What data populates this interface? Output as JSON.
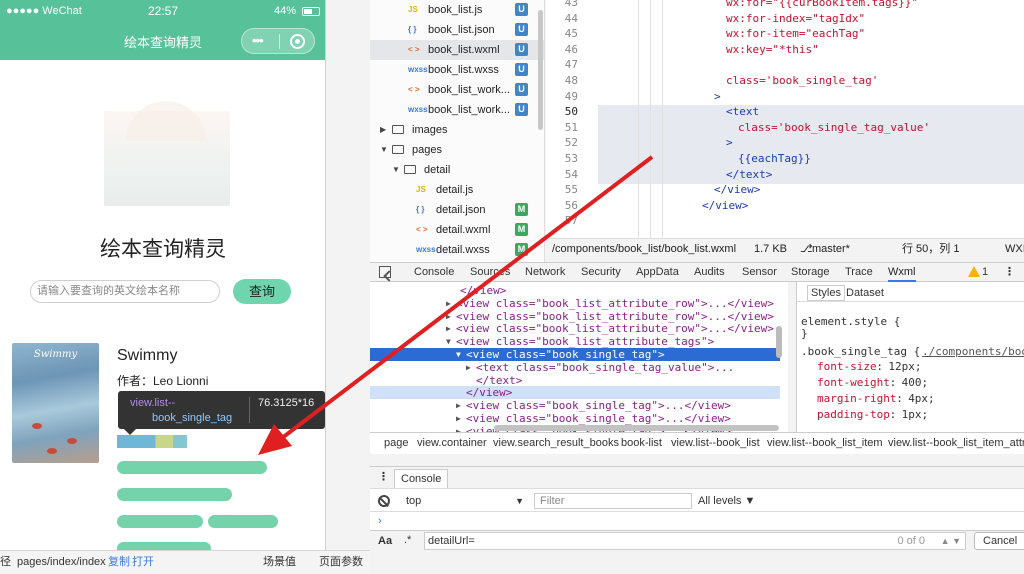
{
  "simulator": {
    "status": {
      "carrier": "●●●●● WeChat",
      "time": "22:57",
      "battery": "44%"
    },
    "nav_title": "绘本查询精灵",
    "capsule_dots": "•••",
    "app_title": "绘本查询精灵",
    "search_placeholder": "请输入要查询的英文绘本名称",
    "search_button": "查询",
    "book": {
      "title": "Swimmy",
      "author": "作者：Leo Lionni",
      "cover_title": "Swimmy"
    },
    "tooltip": {
      "selector_1": "view.list--",
      "selector_2": "book_single_tag",
      "size": "76.3125*16"
    },
    "footer": {
      "path_prefix": "径",
      "path": "pages/index/index",
      "copy": "复制",
      "open": "打开",
      "scene": "场景值",
      "params": "页面参数"
    }
  },
  "file_tree": [
    {
      "icon": "JS",
      "name": "book_list.js",
      "badge": "U"
    },
    {
      "icon": "{ }",
      "name": "book_list.json",
      "badge": "U"
    },
    {
      "icon": "< >",
      "name": "book_list.wxml",
      "badge": "U",
      "selected": true
    },
    {
      "icon": "wxss",
      "name": "book_list.wxss",
      "badge": "U"
    },
    {
      "icon": "< >",
      "name": "book_list_work...",
      "badge": "U"
    },
    {
      "icon": "wxss",
      "name": "book_list_work...",
      "badge": "U"
    },
    {
      "icon": "folder",
      "name": "images",
      "badge": ""
    },
    {
      "icon": "folder",
      "name": "pages",
      "badge": ""
    },
    {
      "icon": "folder",
      "name": "detail",
      "badge": ""
    },
    {
      "icon": "JS",
      "name": "detail.js",
      "badge": ""
    },
    {
      "icon": "{ }",
      "name": "detail.json",
      "badge": "M"
    },
    {
      "icon": "< >",
      "name": "detail.wxml",
      "badge": "M"
    },
    {
      "icon": "wxss",
      "name": "detail.wxss",
      "badge": "M"
    }
  ],
  "editor": {
    "line_numbers": [
      "43",
      "44",
      "45",
      "46",
      "47",
      "48",
      "49",
      "50",
      "51",
      "52",
      "53",
      "54",
      "55",
      "56",
      "57"
    ],
    "lines": [
      "wx:for=\"{{curBookItem.tags}}\"",
      "wx:for-index=\"tagIdx\"",
      "wx:for-item=\"eachTag\"",
      "wx:key=\"*this\"",
      "",
      "class='book_single_tag'",
      ">",
      "<text",
      "class='book_single_tag_value'",
      ">",
      "{{eachTag}}",
      "</text>",
      "</view>",
      "</view>",
      ""
    ],
    "status": {
      "path": "/components/book_list/book_list.wxml",
      "size": "1.7 KB",
      "branch": "master*",
      "position": "行 50，列 1",
      "lang": "WXI"
    }
  },
  "devtools": {
    "tabs": [
      "Console",
      "Sources",
      "Network",
      "Security",
      "AppData",
      "Audits",
      "Sensor",
      "Storage",
      "Trace",
      "Wxml"
    ],
    "active_tab": "Wxml",
    "warnings": "1",
    "dom_lines": [
      "</view>",
      "<view class=\"book_list_attribute_row\">...</view>",
      "<view class=\"book_list_attribute_row\">...</view>",
      "<view class=\"book_list_attribute_row\">...</view>",
      "<view class=\"book_list_attribute_tags\">",
      "<view class=\"book_single_tag\">",
      "<text class=\"book_single_tag_value\">...",
      "</text>",
      "</view>",
      "<view class=\"book_single_tag\">...</view>",
      "<view class=\"book_single_tag\">...</view>",
      "<view class=\"book_single_tag\">...</view>"
    ],
    "styles": {
      "tabs": [
        "Styles",
        "Dataset"
      ],
      "element_style": "element.style {",
      "close": "}",
      "selector": ".book_single_tag {",
      "link": "./components/boo",
      "props": [
        {
          "name": "font-size",
          "value": "12px;"
        },
        {
          "name": "font-weight",
          "value": "400;"
        },
        {
          "name": "margin-right",
          "value": "4px;"
        },
        {
          "name": "padding-top",
          "value": "1px;"
        }
      ]
    },
    "breadcrumb": [
      "page",
      "view.container",
      "view.search_result_books",
      "book-list",
      "view.list--book_list",
      "view.list--book_list_item",
      "view.list--book_list_item_attri"
    ],
    "console": {
      "tab": "Console",
      "context": "top",
      "filter_placeholder": "Filter",
      "levels": "All levels ▼",
      "search_value": "detailUrl=",
      "match_count": "0 of 0",
      "cancel": "Cancel"
    }
  },
  "colors": {
    "accent": "#57c29a",
    "tag_green": "#74d3aa",
    "selection_blue": "#2d6bd4",
    "arrow_red": "#e02020"
  }
}
